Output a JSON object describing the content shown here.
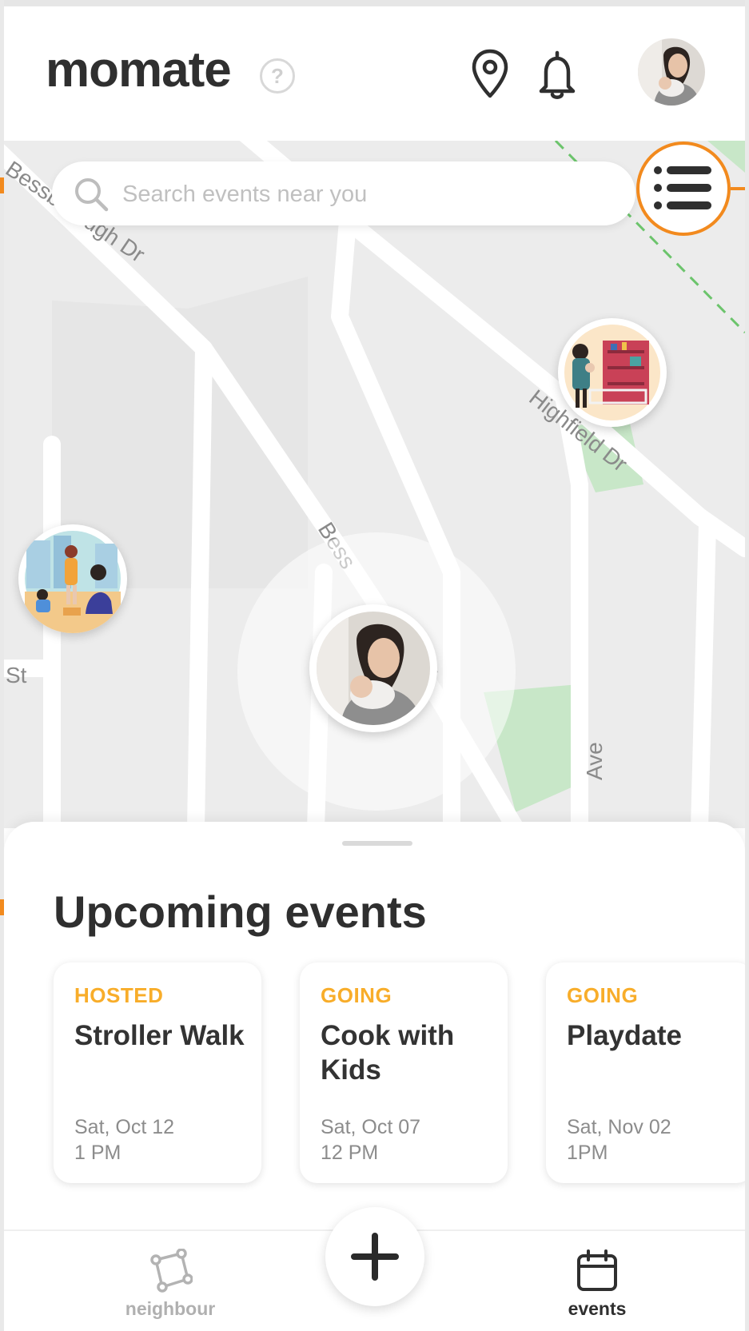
{
  "app": {
    "logo": "momate",
    "help_symbol": "?"
  },
  "header": {
    "icons": [
      "location-pin-icon",
      "bell-icon"
    ],
    "avatar": "profile-avatar"
  },
  "search": {
    "placeholder": "Search events near you"
  },
  "map": {
    "street_labels": [
      "Bessborough Dr",
      "Highfield Dr",
      "Bess",
      "Dr",
      "St",
      "Ave"
    ],
    "pins": [
      "playroom-event-pin",
      "beach-event-pin",
      "current-user-pin"
    ]
  },
  "sheet": {
    "title": "Upcoming events",
    "events": [
      {
        "status": "HOSTED",
        "name": "Stroller Walk",
        "date": "Sat, Oct 12",
        "time": "1 PM"
      },
      {
        "status": "GOING",
        "name": "Cook with Kids",
        "date": "Sat, Oct 07",
        "time": "12 PM"
      },
      {
        "status": "GOING",
        "name": "Playdate",
        "date": "Sat, Nov 02",
        "time": "1PM"
      }
    ]
  },
  "nav": {
    "items": [
      {
        "label": "neighbour",
        "icon": "neighbour-icon",
        "active": false
      },
      {
        "label": "events",
        "icon": "calendar-icon",
        "active": true
      }
    ],
    "add_icon": "plus-icon"
  },
  "colors": {
    "accent": "#f28a1e",
    "status": "#f8ad2a",
    "text": "#2f2f2f",
    "muted": "#8c8c8c",
    "map_bg": "#ececec",
    "park": "#c8e7c8"
  }
}
